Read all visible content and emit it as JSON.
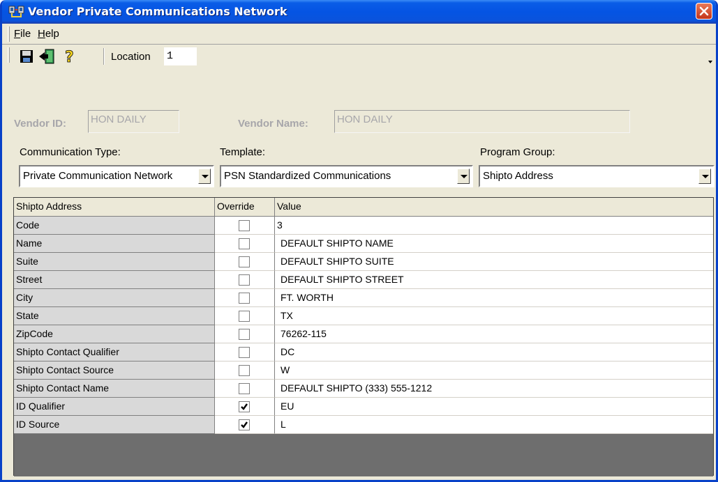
{
  "window": {
    "title": "Vendor Private Communications Network"
  },
  "menu": {
    "file": "File",
    "help": "Help"
  },
  "toolbar": {
    "location_label": "Location",
    "location_value": "1"
  },
  "vendor": {
    "id_label": "Vendor ID:",
    "id_value": "HON DAILY",
    "name_label": "Vendor Name:",
    "name_value": "HON DAILY"
  },
  "selectors": {
    "communication_type": {
      "label": "Communication Type:",
      "value": "Private Communication Network"
    },
    "template": {
      "label": "Template:",
      "value": "PSN Standardized Communications"
    },
    "program_group": {
      "label": "Program Group:",
      "value": "Shipto Address"
    }
  },
  "grid": {
    "headers": {
      "name": "Shipto Address",
      "override": "Override",
      "value": "Value"
    },
    "rows": [
      {
        "name": "Code",
        "override": false,
        "value": "3"
      },
      {
        "name": "Name",
        "override": false,
        "value": "DEFAULT SHIPTO NAME"
      },
      {
        "name": "Suite",
        "override": false,
        "value": "DEFAULT SHIPTO SUITE"
      },
      {
        "name": "Street",
        "override": false,
        "value": "DEFAULT SHIPTO STREET"
      },
      {
        "name": "City",
        "override": false,
        "value": "FT. WORTH"
      },
      {
        "name": "State",
        "override": false,
        "value": "TX"
      },
      {
        "name": "ZipCode",
        "override": false,
        "value": "76262-115"
      },
      {
        "name": "Shipto Contact Qualifier",
        "override": false,
        "value": "DC"
      },
      {
        "name": "Shipto Contact Source",
        "override": false,
        "value": "W"
      },
      {
        "name": "Shipto Contact Name",
        "override": false,
        "value": "DEFAULT SHIPTO (333) 555-1212"
      },
      {
        "name": "ID Qualifier",
        "override": true,
        "value": "EU"
      },
      {
        "name": "ID Source",
        "override": true,
        "value": "L"
      }
    ]
  },
  "colors": {
    "titlebar": "#0554E3",
    "window_bg": "#ECE9D8",
    "disabled_text": "#A7A6AA",
    "name_col_bg": "#D9D9D9",
    "empty_grid": "#6E6E6E"
  }
}
